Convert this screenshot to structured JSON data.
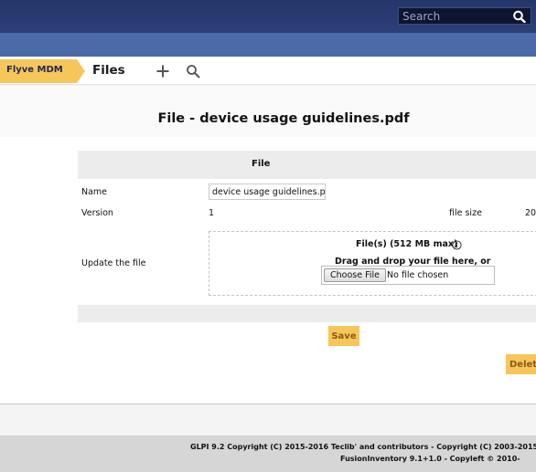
{
  "header": {
    "search_placeholder": "Search"
  },
  "breadcrumb": {
    "home": "Flyve MDM",
    "current": "Files"
  },
  "page": {
    "title": "File - device usage guidelines.pdf"
  },
  "form": {
    "section_title": "File",
    "name_label": "Name",
    "name_value": "device usage guidelines.pdf",
    "version_label": "Version",
    "version_value": "1",
    "filesize_label": "file size",
    "filesize_value": "20",
    "update_label": "Update the file",
    "dropzone_title": "File(s) (512 MB max)",
    "dropzone_hint": "Drag and drop your file here, or",
    "choose_file": "Choose File",
    "no_file": "No file chosen",
    "save": "Save",
    "delete": "Delete"
  },
  "footer": {
    "copyright_glpi": "GLPI 9.2 Copyright (C) 2015-2016 Teclib' and contributors - Copyright (C) 2003-2015",
    "copyright_fusion": "FusionInventory 9.1+1.0 - Copyleft © 2010-"
  },
  "colors": {
    "topbar": "#25366a",
    "subbar": "#4a6ba8",
    "breadcrumb_tab": "#f7c65a",
    "button": "#f7c65a"
  }
}
